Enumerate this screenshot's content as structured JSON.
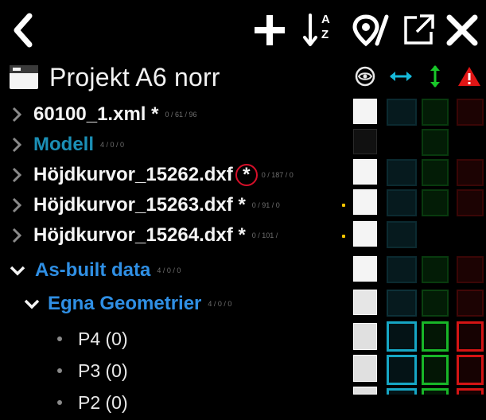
{
  "toolbar": {
    "back_icon": "chevron-left-icon",
    "add_icon": "plus-icon",
    "sort_icon": "sort-az-icon",
    "sort_label_top": "A",
    "sort_label_bottom": "Z",
    "map_pin_icon": "map-pin-slash-icon",
    "open_external_icon": "open-external-icon",
    "close_icon": "close-icon"
  },
  "project": {
    "icon": "folder-box-icon",
    "title": "Projekt A6 norr"
  },
  "columns": [
    {
      "icon": "eye-icon",
      "color": "#e8e8e8"
    },
    {
      "icon": "horizontal-arrows-icon",
      "color": "#16b9d9"
    },
    {
      "icon": "vertical-arrows-icon",
      "color": "#18c829"
    },
    {
      "icon": "warning-icon",
      "color": "#e01515"
    }
  ],
  "colors": {
    "cyan": "#16b9d9",
    "green": "#18c829",
    "red": "#e01515",
    "blue_link": "#2f8fe4",
    "teal_link": "#1b8fb5"
  },
  "rows": [
    {
      "name": "60100_1.xml *",
      "meta": "0 / 61 / 96"
    },
    {
      "name": "Modell",
      "meta": "4 / 0 / 0"
    },
    {
      "name": "Höjdkurvor_15262.dxf",
      "star": "*",
      "meta": "0 / 187 / 0"
    },
    {
      "name": "Höjdkurvor_15263.dxf *",
      "meta": "0 / 91 / 0"
    },
    {
      "name": "Höjdkurvor_15264.dxf *",
      "meta": "0 / 101 /"
    },
    {
      "name": "As-built data",
      "meta": "4 / 0 / 0"
    },
    {
      "name": "Egna Geometrier",
      "meta": "4 / 0 / 0"
    },
    {
      "name": "P4 (0)"
    },
    {
      "name": "P3 (0)"
    },
    {
      "name": "P2 (0)"
    }
  ]
}
